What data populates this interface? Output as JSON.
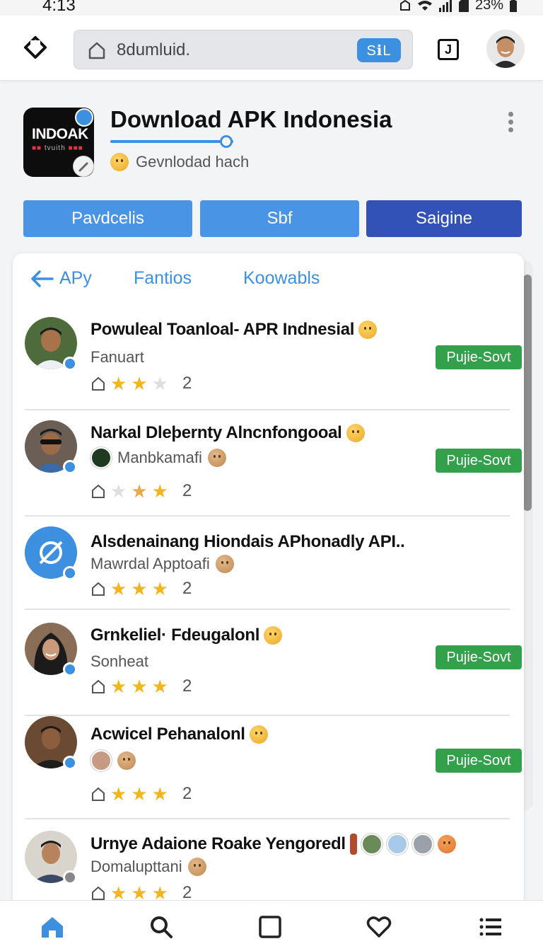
{
  "status_bar": {
    "time": "4:13",
    "battery": "23%"
  },
  "browser": {
    "url": "8dumluid.",
    "ssl_label": "SℹL",
    "tab_label": "J"
  },
  "app": {
    "icon_title": "INDOAK",
    "icon_subtitle": "tvuith",
    "title": "Download APK Indonesia",
    "subtitle": "Gevnlodad hach",
    "progress": 0.95
  },
  "actions": [
    {
      "label": "Pavdcelis"
    },
    {
      "label": "Sbf"
    },
    {
      "label": "Saigine"
    }
  ],
  "tabs": {
    "back_label": "APy",
    "tab2": "Fantios",
    "tab3": "Koowabls"
  },
  "items": [
    {
      "title": "Powuleal Toanloal- APR Indnesial",
      "sub": "Fanuart",
      "rating": 2,
      "count": "2",
      "badge": "Pujie-Sovt"
    },
    {
      "title": "Narkal Dleþernty Alncnfongooal",
      "sub": "Manbkamafi",
      "rating": 2,
      "count": "2",
      "badge": "Pujie-Sovt"
    },
    {
      "title": "Alsdenainang Hiondais APhonadly API..",
      "sub": "Mawrdal Apptoafi",
      "rating": 3,
      "count": "2",
      "badge": ""
    },
    {
      "title": "Grnkeliel· Fdeugalonl",
      "sub": "Sonheat",
      "rating": 3,
      "count": "2",
      "badge": "Pujie-Sovt"
    },
    {
      "title": "Acwicel Pehanalonl",
      "sub": "",
      "rating": 3,
      "count": "2",
      "badge": "Pujie-Sovt"
    },
    {
      "title": "Urnye Adaione Roake Yengoredl",
      "sub": "Domalupttani",
      "rating": 3,
      "count": "2",
      "badge": ""
    }
  ],
  "colors": {
    "accent": "#3d8fe0",
    "primary_dark": "#3252b8",
    "badge_green": "#33a04c",
    "star": "#f2b51c"
  },
  "bottom_nav": [
    "home-icon",
    "search-icon",
    "square-icon",
    "heart-icon",
    "menu-icon"
  ]
}
